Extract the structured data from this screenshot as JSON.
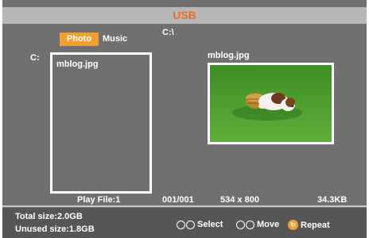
{
  "header": {
    "title": "USB"
  },
  "tabs": [
    {
      "label": "Photo",
      "active": true
    },
    {
      "label": "Music",
      "active": false
    }
  ],
  "path": "C:\\",
  "drive": "C:",
  "files": [
    "mblog.jpg"
  ],
  "preview": {
    "filename": "mblog.jpg"
  },
  "info": {
    "play_file": "Play File:1",
    "index": "001/001",
    "resolution": "534 x 800",
    "size": "34.3KB"
  },
  "footer": {
    "total_size": "Total size:2.0GB",
    "unused_size": "Unused size:1.8GB",
    "hints": [
      {
        "label": "Select",
        "icon": "up-down-arrows-icon"
      },
      {
        "label": "Move",
        "icon": "left-right-arrows-icon"
      },
      {
        "label": "Repeat",
        "icon": "repeat-icon"
      }
    ]
  },
  "colors": {
    "title": "#e8702c",
    "active_tab": "#f0a030",
    "background": "#707070",
    "title_bar": "#b7b7b7"
  }
}
